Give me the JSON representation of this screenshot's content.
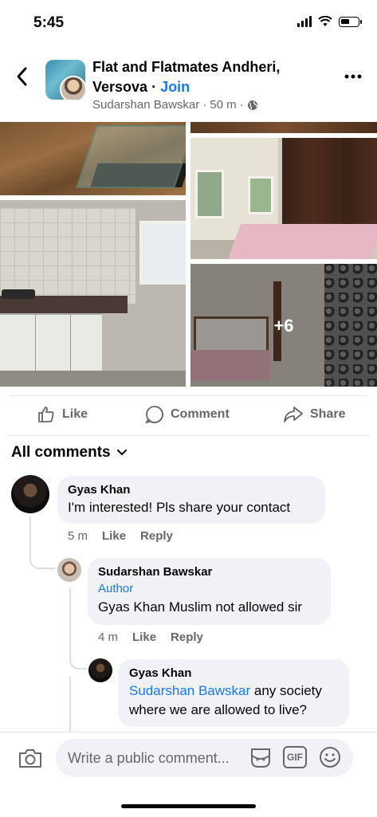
{
  "status_bar": {
    "time": "5:45",
    "icons": [
      "signal-icon",
      "wifi-icon",
      "battery-icon"
    ]
  },
  "header": {
    "group_name": "Flat and Flatmates Andheri, Versova",
    "separator": " · ",
    "join_label": "Join",
    "author": "Sudarshan Bawskar",
    "time": "50 m",
    "icons": [
      "back-icon",
      "more-icon",
      "globe-icon"
    ]
  },
  "photos": {
    "more_count": "+6"
  },
  "actions": {
    "like": "Like",
    "comment": "Comment",
    "share": "Share"
  },
  "comments_header": {
    "label": "All comments"
  },
  "comments": [
    {
      "name": "Gyas Khan",
      "text": "I'm interested! Pls share your contact",
      "time": "5 m",
      "like": "Like",
      "reply": "Reply"
    },
    {
      "name": "Sudarshan Bawskar",
      "badge": "Author",
      "text": "Gyas Khan Muslim not allowed sir",
      "time": "4 m",
      "like": "Like",
      "reply": "Reply"
    },
    {
      "name": "Gyas Khan",
      "mention": "Sudarshan Bawskar",
      "text": " any society where we are allowed to live?"
    }
  ],
  "composer": {
    "placeholder": "Write a public comment...",
    "gif_label": "GIF"
  },
  "colors": {
    "accent": "#1877f2",
    "secondary_text": "#65676b",
    "bubble": "#f0f2f5"
  }
}
